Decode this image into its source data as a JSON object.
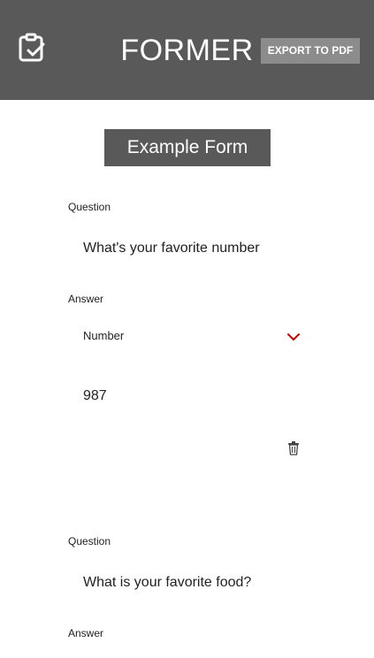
{
  "header": {
    "logo_icon": "clipboard-check-icon",
    "title": "FORMER",
    "export_label": "EXPORT TO PDF",
    "background": "#595959"
  },
  "form": {
    "title": "Example Form",
    "questions": [
      {
        "question_label": "Question",
        "question_text": "What's your favorite number",
        "answer_label": "Answer",
        "answer_type": "Number",
        "answer_value": "987",
        "delete_icon": "trash-icon"
      },
      {
        "question_label": "Question",
        "question_text": "What is your favorite food?",
        "answer_label": "Answer"
      }
    ]
  },
  "colors": {
    "accent_chevron": "#cc0000",
    "export_button": "#8c8c8c"
  }
}
